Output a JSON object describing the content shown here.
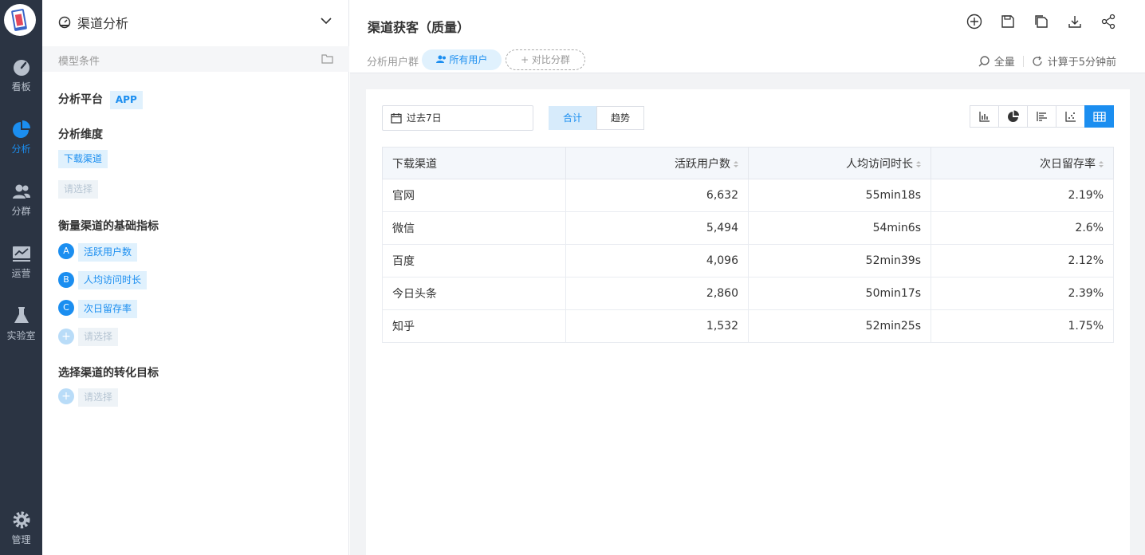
{
  "nav": {
    "items": [
      {
        "label": "看板",
        "icon": "dashboard-icon"
      },
      {
        "label": "分析",
        "icon": "pie-chart-icon",
        "active": true
      },
      {
        "label": "分群",
        "icon": "users-icon"
      },
      {
        "label": "运营",
        "icon": "monitor-chart-icon"
      },
      {
        "label": "实验室",
        "icon": "flask-icon"
      },
      {
        "label": "管理",
        "icon": "gear-icon"
      }
    ]
  },
  "panel": {
    "title": "渠道分析",
    "model_conditions": "模型条件",
    "platform": {
      "label": "分析平台",
      "value": "APP"
    },
    "dimension": {
      "label": "分析维度",
      "selected": "下载渠道",
      "placeholder": "请选择"
    },
    "metrics": {
      "label": "衡量渠道的基础指标",
      "items": [
        {
          "index": "A",
          "label": "活跃用户数"
        },
        {
          "index": "B",
          "label": "人均访问时长"
        },
        {
          "index": "C",
          "label": "次日留存率"
        }
      ],
      "add_placeholder": "请选择"
    },
    "goal": {
      "label": "选择渠道的转化目标",
      "placeholder": "请选择"
    }
  },
  "header": {
    "title": "渠道获客（质量）",
    "segment_label": "分析用户群",
    "all_users": "所有用户",
    "compare": "+ 对比分群",
    "scope": "全量",
    "computed": "计算于5分钟前"
  },
  "toolbar": {
    "date_range": "过去7日",
    "toggle": [
      "合计",
      "趋势"
    ],
    "chart_types": [
      "bar-chart-icon",
      "pie-chart-icon",
      "horizontal-bar-icon",
      "scatter-icon",
      "table-icon"
    ]
  },
  "table": {
    "columns": [
      "下载渠道",
      "活跃用户数",
      "人均访问时长",
      "次日留存率"
    ],
    "rows": [
      [
        "官网",
        "6,632",
        "55min18s",
        "2.19%"
      ],
      [
        "微信",
        "5,494",
        "54min6s",
        "2.6%"
      ],
      [
        "百度",
        "4,096",
        "52min39s",
        "2.12%"
      ],
      [
        "今日头条",
        "2,860",
        "50min17s",
        "2.39%"
      ],
      [
        "知乎",
        "1,532",
        "52min25s",
        "1.75%"
      ]
    ]
  },
  "colors": {
    "accent": "#1b8ef0",
    "rail": "#2b3443"
  }
}
